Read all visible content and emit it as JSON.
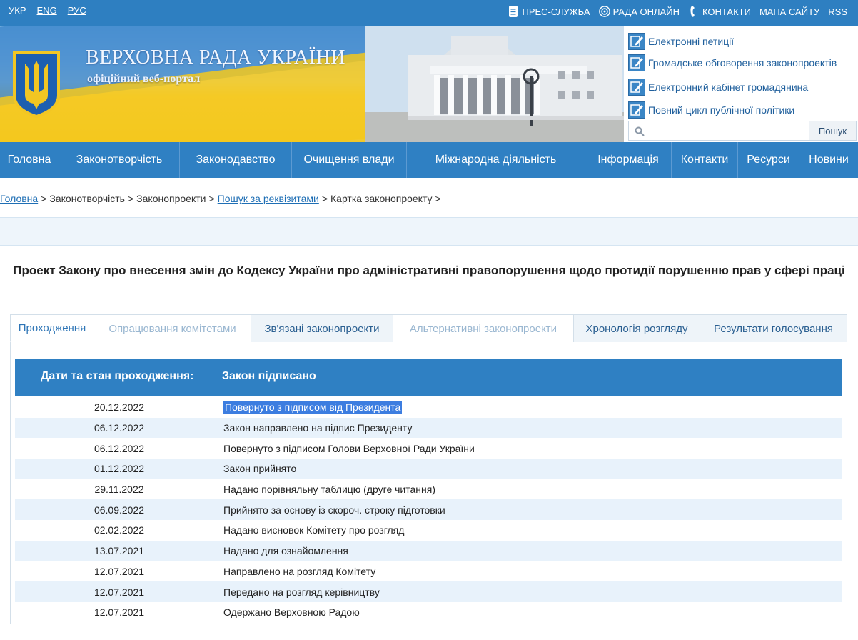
{
  "topbar": {
    "languages": [
      "УКР",
      "ENG",
      "РУС"
    ],
    "links": [
      "ПРЕС-СЛУЖБА",
      "РАДА ОНЛАЙН",
      "КОНТАКТИ",
      "МАПА САЙТУ",
      "RSS"
    ]
  },
  "header": {
    "portal_title": "ВЕРХОВНА РАДА УКРАЇНИ",
    "portal_subtitle": "офіційний веб-портал",
    "side_links": [
      "Електронні петиції",
      "Громадське обговорення законопроектів",
      "Електронний кабінет громадянина",
      "Повний цикл публічної політики"
    ],
    "search_placeholder": "",
    "search_button": "Пошук"
  },
  "nav": [
    "Головна",
    "Законотворчість",
    "Законодавство",
    "Очищення влади",
    "Міжнародна діяльність",
    "Інформація",
    "Контакти",
    "Ресурси",
    "Новини"
  ],
  "breadcrumb": {
    "items": [
      {
        "label": "Головна",
        "link": true
      },
      {
        "label": "Законотворчість",
        "link": false
      },
      {
        "label": "Законопроекти",
        "link": false
      },
      {
        "label": "Пошук за реквізитами",
        "link": true
      },
      {
        "label": "Картка законопроекту",
        "link": false
      }
    ]
  },
  "bill": {
    "title": "Проект Закону про внесення змін до Кодексу України про адміністративні правопорушення щодо протидії порушенню прав у сфері праці"
  },
  "tabs": [
    {
      "label": "Проходження",
      "state": "active"
    },
    {
      "label": "Опрацювання комітетами",
      "state": "dim"
    },
    {
      "label": "Зв'язані законопроекти",
      "state": "norm"
    },
    {
      "label": "Альтернативні законопроекти",
      "state": "dim"
    },
    {
      "label": "Хронологія розгляду",
      "state": "norm"
    },
    {
      "label": "Результати голосування",
      "state": "norm"
    }
  ],
  "table": {
    "header_left": "Дати та стан проходження:",
    "header_right": "Закон підписано",
    "rows": [
      {
        "date": "20.12.2022",
        "status": "Повернуто з підписом від Президента",
        "selected": true
      },
      {
        "date": "06.12.2022",
        "status": "Закон направлено на підпис Президенту"
      },
      {
        "date": "06.12.2022",
        "status": "Повернуто з підписом Голови Верховної Ради України"
      },
      {
        "date": "01.12.2022",
        "status": "Закон прийнято"
      },
      {
        "date": "29.11.2022",
        "status": "Надано порівняльну таблицю (друге читання)"
      },
      {
        "date": "06.09.2022",
        "status": "Прийнято за основу із скороч. строку підготовки"
      },
      {
        "date": "02.02.2022",
        "status": "Надано висновок Комітету про розгляд"
      },
      {
        "date": "13.07.2021",
        "status": "Надано для ознайомлення"
      },
      {
        "date": "12.07.2021",
        "status": "Направлено на розгляд Комітету"
      },
      {
        "date": "12.07.2021",
        "status": "Передано на розгляд керівництву"
      },
      {
        "date": "12.07.2021",
        "status": "Одержано Верховною Радою"
      }
    ]
  }
}
